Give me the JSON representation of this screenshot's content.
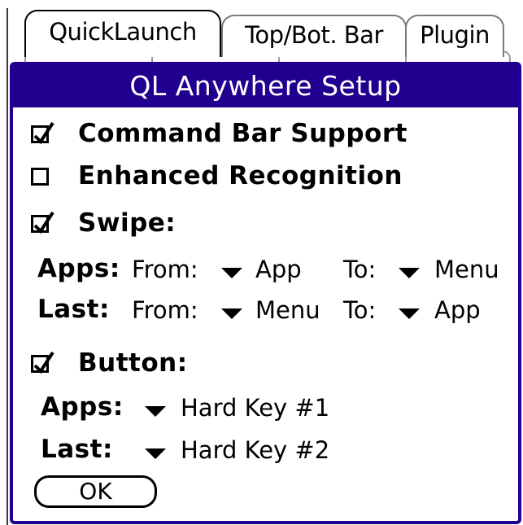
{
  "tabs": [
    {
      "label": "QuickLaunch",
      "active": true
    },
    {
      "label": "Top/Bot. Bar",
      "active": false
    },
    {
      "label": "Plugin",
      "active": false
    }
  ],
  "dialog": {
    "title": "QL Anywhere Setup",
    "command_bar_support": {
      "label": "Command Bar Support",
      "checked": true
    },
    "enhanced_recognition": {
      "label": "Enhanced Recognition",
      "checked": false
    },
    "swipe": {
      "label": "Swipe:",
      "checked": true,
      "apps": {
        "label": "Apps:",
        "from_label": "From:",
        "from_value": "App",
        "to_label": "To:",
        "to_value": "Menu"
      },
      "last": {
        "label": "Last:",
        "from_label": "From:",
        "from_value": "Menu",
        "to_label": "To:",
        "to_value": "App"
      }
    },
    "button": {
      "label": "Button:",
      "checked": true,
      "apps": {
        "label": "Apps:",
        "value": "Hard Key #1"
      },
      "last": {
        "label": "Last:",
        "value": "Hard Key #2"
      }
    },
    "ok_label": "OK"
  },
  "colors": {
    "title_bar": "#22008f",
    "title_text": "#ffffff"
  }
}
